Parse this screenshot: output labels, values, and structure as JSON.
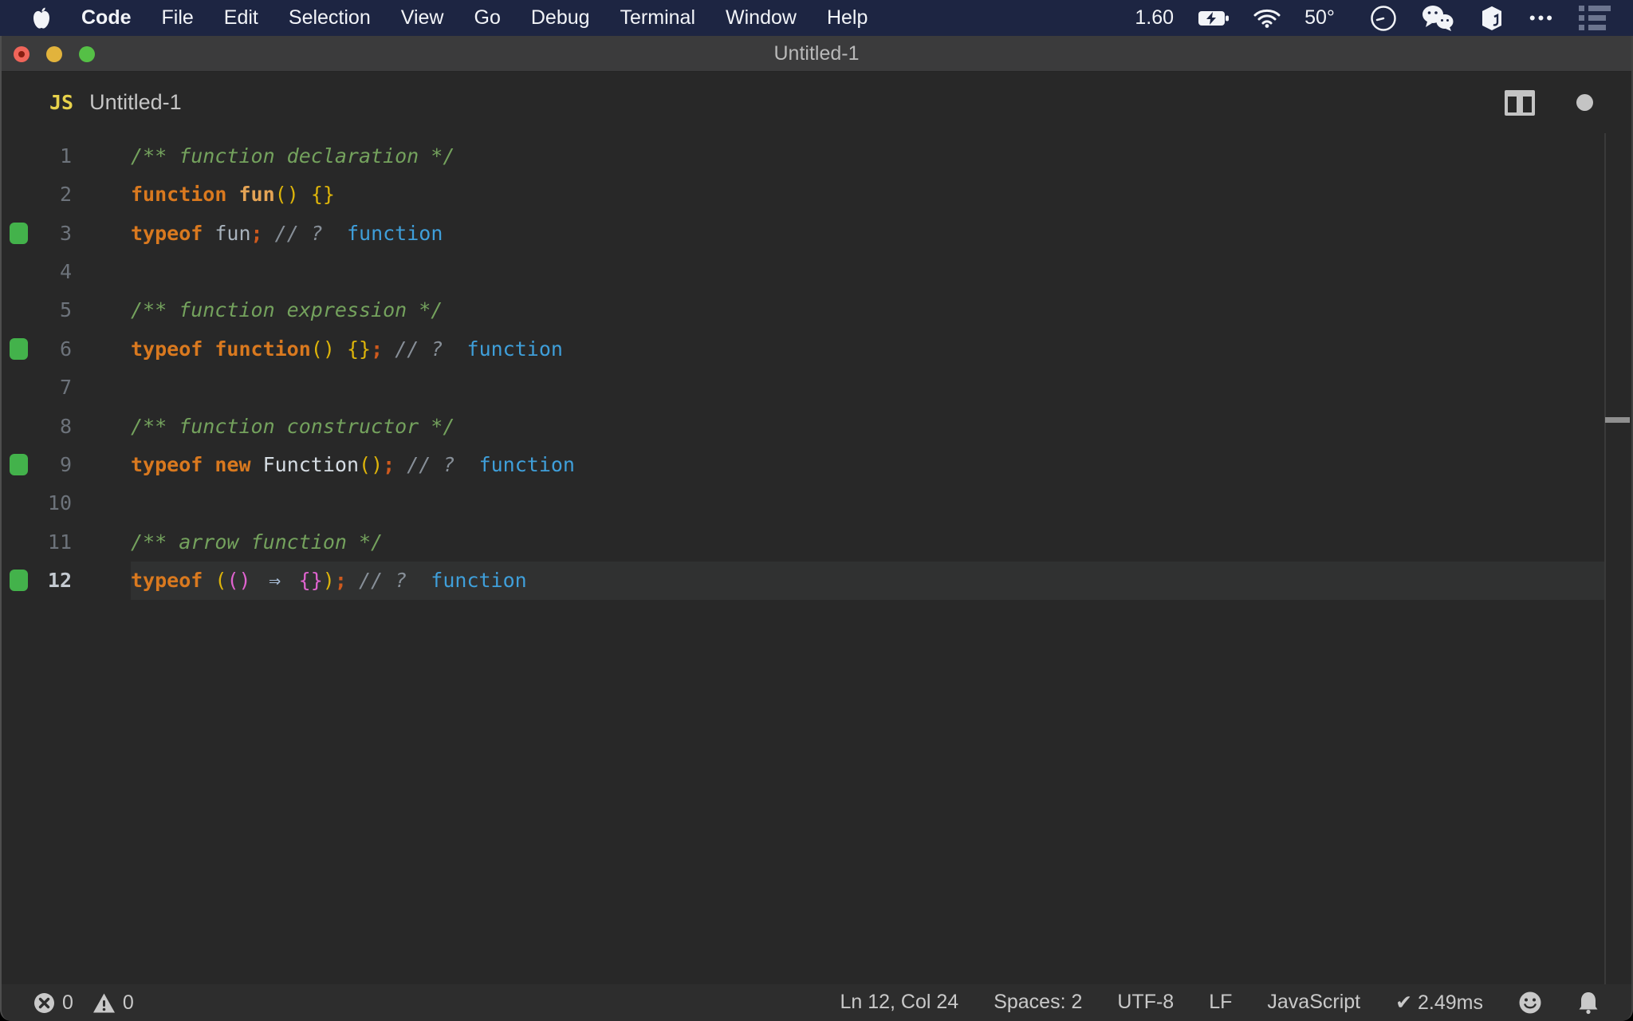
{
  "palette": {
    "menubar-bg": "#1d2542",
    "menubar-text": "#f2f4f8",
    "titlebar-bg": "#3b3b3c",
    "editor-bg": "#282828",
    "statusbar-bg": "#2d2d2d",
    "line-highlight": "#303131",
    "marker-green": "#43b24b",
    "lineno": "#6d737b",
    "lineno-active": "#c4cad1",
    "ui-text": "#c9c9c9",
    "kw": "#d9791f",
    "fname": "#e5a455",
    "b1": "#ddb40a",
    "b2": "#df63cf",
    "plain": "#a8b2bc",
    "cls": "#d6dde4",
    "semi": "#cf5a1d",
    "comment": "#74a25d",
    "comment2": "#878f98",
    "arrow": "#a9bed8",
    "result": "#3f9fda"
  },
  "menubar": {
    "items": [
      "Code",
      "File",
      "Edit",
      "Selection",
      "View",
      "Go",
      "Debug",
      "Terminal",
      "Window",
      "Help"
    ],
    "widgets": {
      "value": "1.60",
      "temp": "50°",
      "ellipsis": "•••",
      "icons": [
        "apple-logo",
        "battery-charging-icon",
        "wifi-icon",
        "clock-icon",
        "wechat-icon",
        "cube-icon",
        "ellipsis-icon",
        "task-list-icon"
      ]
    }
  },
  "window": {
    "title": "Untitled-1"
  },
  "tab": {
    "badge": "JS",
    "filename": "Untitled-1",
    "icons": [
      "split-editor-icon",
      "unsaved-dot-icon"
    ]
  },
  "editor": {
    "lines": [
      {
        "num": "1",
        "marker": false,
        "current": false,
        "tokens": [
          {
            "t": "/** function declaration */",
            "c": "comment"
          }
        ]
      },
      {
        "num": "2",
        "marker": false,
        "current": false,
        "tokens": [
          {
            "t": "function",
            "c": "kw"
          },
          {
            "t": " ",
            "c": "plain"
          },
          {
            "t": "fun",
            "c": "fname"
          },
          {
            "t": "()",
            "c": "b1"
          },
          {
            "t": " ",
            "c": "plain"
          },
          {
            "t": "{}",
            "c": "b1"
          }
        ]
      },
      {
        "num": "3",
        "marker": true,
        "current": false,
        "tokens": [
          {
            "t": "typeof",
            "c": "kw"
          },
          {
            "t": " fun",
            "c": "plain"
          },
          {
            "t": ";",
            "c": "semi"
          },
          {
            "t": " ",
            "c": "plain"
          },
          {
            "t": "// ?",
            "c": "comment2"
          },
          {
            "t": "  function",
            "c": "result"
          }
        ]
      },
      {
        "num": "4",
        "marker": false,
        "current": false,
        "tokens": []
      },
      {
        "num": "5",
        "marker": false,
        "current": false,
        "tokens": [
          {
            "t": "/** function expression */",
            "c": "comment"
          }
        ]
      },
      {
        "num": "6",
        "marker": true,
        "current": false,
        "tokens": [
          {
            "t": "typeof",
            "c": "kw"
          },
          {
            "t": " ",
            "c": "plain"
          },
          {
            "t": "function",
            "c": "kw"
          },
          {
            "t": "()",
            "c": "b1"
          },
          {
            "t": " ",
            "c": "plain"
          },
          {
            "t": "{}",
            "c": "b1"
          },
          {
            "t": ";",
            "c": "semi"
          },
          {
            "t": " ",
            "c": "plain"
          },
          {
            "t": "// ?",
            "c": "comment2"
          },
          {
            "t": "  function",
            "c": "result"
          }
        ]
      },
      {
        "num": "7",
        "marker": false,
        "current": false,
        "tokens": []
      },
      {
        "num": "8",
        "marker": false,
        "current": false,
        "tokens": [
          {
            "t": "/** function constructor */",
            "c": "comment"
          }
        ]
      },
      {
        "num": "9",
        "marker": true,
        "current": false,
        "tokens": [
          {
            "t": "typeof",
            "c": "kw"
          },
          {
            "t": " ",
            "c": "plain"
          },
          {
            "t": "new",
            "c": "kw"
          },
          {
            "t": " ",
            "c": "plain"
          },
          {
            "t": "Function",
            "c": "cls"
          },
          {
            "t": "()",
            "c": "b1"
          },
          {
            "t": ";",
            "c": "semi"
          },
          {
            "t": " ",
            "c": "plain"
          },
          {
            "t": "// ?",
            "c": "comment2"
          },
          {
            "t": "  function",
            "c": "result"
          }
        ]
      },
      {
        "num": "10",
        "marker": false,
        "current": false,
        "tokens": []
      },
      {
        "num": "11",
        "marker": false,
        "current": false,
        "tokens": [
          {
            "t": "/** arrow function */",
            "c": "comment"
          }
        ]
      },
      {
        "num": "12",
        "marker": true,
        "current": true,
        "tokens": [
          {
            "t": "typeof",
            "c": "kw"
          },
          {
            "t": " ",
            "c": "plain"
          },
          {
            "t": "(",
            "c": "b1"
          },
          {
            "t": "()",
            "c": "b2"
          },
          {
            "t": " ",
            "c": "plain"
          },
          {
            "t": "⇒",
            "c": "arrow"
          },
          {
            "t": " ",
            "c": "plain"
          },
          {
            "t": "{}",
            "c": "b2"
          },
          {
            "t": ")",
            "c": "b1"
          },
          {
            "t": ";",
            "c": "semi"
          },
          {
            "t": " ",
            "c": "plain"
          },
          {
            "t": "// ?",
            "c": "comment2"
          },
          {
            "t": "  function",
            "c": "result"
          }
        ]
      }
    ]
  },
  "statusbar": {
    "errors": "0",
    "warnings": "0",
    "right_items": [
      {
        "name": "cursor-position",
        "label": "Ln 12, Col 24"
      },
      {
        "name": "indentation",
        "label": "Spaces: 2"
      },
      {
        "name": "encoding",
        "label": "UTF-8"
      },
      {
        "name": "eol",
        "label": "LF"
      },
      {
        "name": "language-mode",
        "label": "JavaScript"
      },
      {
        "name": "quokka-perf",
        "label": "✔ 2.49ms"
      }
    ],
    "icons": [
      "errors-icon",
      "warnings-icon",
      "feedback-smiley-icon",
      "notifications-bell-icon"
    ]
  }
}
